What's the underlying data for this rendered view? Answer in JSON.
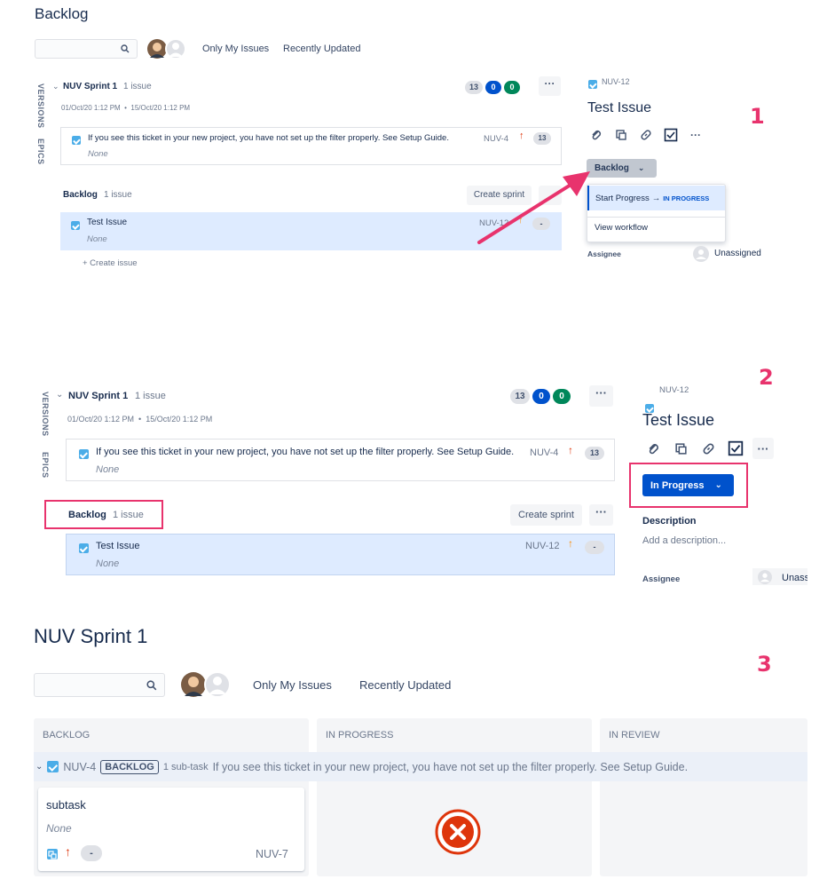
{
  "panel1": {
    "title": "Backlog",
    "filters": [
      "Only My Issues",
      "Recently Updated"
    ],
    "side_tabs": [
      "VERSIONS",
      "EPICS"
    ],
    "sprint": {
      "name": "NUV Sprint 1",
      "count": "1 issue",
      "dates": "01/Oct/20 1:12 PM  •  15/Oct/20 1:12 PM",
      "badges": [
        "13",
        "0",
        "0"
      ],
      "issue": {
        "text": "If you see this ticket in your new project, you have not set up the filter properly. See Setup Guide.",
        "key": "NUV-4",
        "points": "13",
        "epic": "None"
      }
    },
    "backlog": {
      "name": "Backlog",
      "count": "1 issue",
      "create_sprint": "Create sprint",
      "issue": {
        "text": "Test Issue",
        "key": "NUV-12",
        "points": "-",
        "epic": "None"
      },
      "create_issue": "+ Create issue"
    },
    "detail": {
      "key": "NUV-12",
      "title": "Test Issue",
      "status_button": "Backlog",
      "menu": {
        "start_progress": "Start Progress",
        "target": "IN PROGRESS",
        "view_workflow": "View workflow"
      },
      "assignee_label": "Assignee",
      "assignee_value": "Unassigned"
    },
    "step": "1"
  },
  "panel2": {
    "side_tabs": [
      "VERSIONS",
      "EPICS"
    ],
    "sprint": {
      "name": "NUV Sprint 1",
      "count": "1 issue",
      "dates": "01/Oct/20 1:12 PM  •  15/Oct/20 1:12 PM",
      "badges": [
        "13",
        "0",
        "0"
      ],
      "issue": {
        "text": "If you see this ticket in your new project, you have not set up the filter properly. See Setup Guide.",
        "key": "NUV-4",
        "points": "13",
        "epic": "None"
      }
    },
    "backlog": {
      "name": "Backlog",
      "count": "1 issue",
      "create_sprint": "Create sprint",
      "issue": {
        "text": "Test Issue",
        "key": "NUV-12",
        "points": "-",
        "epic": "None"
      }
    },
    "detail": {
      "key": "NUV-12",
      "title": "Test Issue",
      "status_button": "In Progress",
      "description_label": "Description",
      "description_placeholder": "Add a description...",
      "assignee_label": "Assignee",
      "assignee_value": "Unass"
    },
    "step": "2"
  },
  "panel3": {
    "title": "NUV Sprint 1",
    "filters": [
      "Only My Issues",
      "Recently Updated"
    ],
    "columns": [
      "BACKLOG",
      "IN PROGRESS",
      "IN REVIEW"
    ],
    "swimlane": {
      "key": "NUV-4",
      "status": "BACKLOG",
      "subtasks": "1 sub-task",
      "summary": "If you see this ticket in your new project, you have not set up the filter properly. See Setup Guide."
    },
    "card": {
      "title": "subtask",
      "epic": "None",
      "points": "-",
      "key": "NUV-7"
    },
    "step": "3"
  },
  "colors": {
    "accent_pink": "#e8336d",
    "jira_blue": "#0052cc",
    "selected_row": "#deebff",
    "error_red": "#de350b"
  }
}
